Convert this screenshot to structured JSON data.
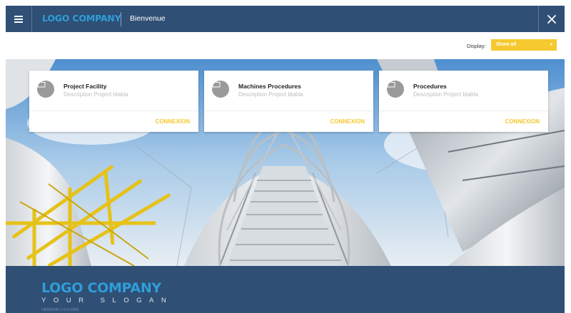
{
  "titlebar": {
    "logo": "LOGO COMPANY",
    "title": "Bienvenue",
    "menu_icon": "hamburger-menu-icon",
    "close_icon": "close-icon"
  },
  "toolbar": {
    "display_label": "Display:",
    "display_value": "Show all",
    "display_color": "#f5c92f"
  },
  "cards": [
    {
      "title": "Project Facility",
      "description": "Description Project blabla",
      "button": "CONNEXION",
      "icon": "folder-icon"
    },
    {
      "title": "Machines Procedures",
      "description": "Description Project blabla",
      "button": "CONNEXION",
      "icon": "folder-icon"
    },
    {
      "title": "Procedures",
      "description": "Description Project blabla",
      "button": "CONNEXION",
      "icon": "folder-icon"
    }
  ],
  "footer": {
    "logo": "LOGO COMPANY",
    "slogan": "YOUR SLOGAN",
    "version": "VERSION 1.0.0.1000"
  },
  "colors": {
    "primary": "#2f4f75",
    "logo_blue": "#2f9ed9",
    "accent_yellow": "#f5c92f"
  }
}
